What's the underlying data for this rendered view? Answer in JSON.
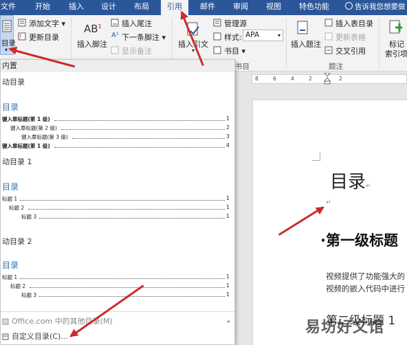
{
  "tabs": [
    "文件",
    "开始",
    "插入",
    "设计",
    "布局",
    "引用",
    "邮件",
    "审阅",
    "视图",
    "特色功能"
  ],
  "active_tab": "引用",
  "tell_me": "告诉我您想要做",
  "ribbon": {
    "toc_label": "目录",
    "add_text": "添加文字",
    "update_toc": "更新目录",
    "ab_icon": "AB",
    "ab_sup": "1",
    "insert_footnote": "插入脚注",
    "insert_endnote": "插入尾注",
    "next_footnote": "下一条脚注",
    "show_notes": "显示备注",
    "insert_citation": "插入引文",
    "manage_sources": "管理源",
    "style_label": "样式:",
    "style_value": "APA",
    "bibliography": "书目",
    "citation_group": "书目",
    "insert_caption": "插入题注",
    "insert_table_figures": "插入表目录",
    "update_table": "更新表格",
    "cross_reference": "交叉引用",
    "caption_group": "题注",
    "mark_entry": "标记",
    "mark_entry2": "索引项"
  },
  "dropdown": {
    "header": "内置",
    "auto1": "动目录",
    "toc_heading": "目录",
    "sample1": [
      {
        "text": "键入章标题(第 1 级)",
        "page": "1",
        "bold": true
      },
      {
        "text": "键入章标题(第 2 级)",
        "page": "2",
        "bold": false
      },
      {
        "text": "键入章标题(第 3 级)",
        "page": "3",
        "bold": false
      },
      {
        "text": "键入章标题(第 1 级)",
        "page": "4",
        "bold": true
      }
    ],
    "auto_toc_1": "动目录 1",
    "toc_heading_2": "目录",
    "sample2": [
      {
        "text": "标题 1",
        "page": "1"
      },
      {
        "text": "标题 2",
        "page": "1"
      },
      {
        "text": "标题 3",
        "page": "1"
      }
    ],
    "auto_toc_2": "动目录 2",
    "toc_heading_3": "目录",
    "sample3": [
      {
        "text": "标题 1",
        "page": "1"
      },
      {
        "text": "标题 2",
        "page": "1"
      },
      {
        "text": "标题 3",
        "page": "1"
      }
    ],
    "office_more": "Office.com 中的其他目录(M)",
    "custom_toc": "自定义目录(C)..."
  },
  "ruler_ticks": [
    "8",
    "6",
    "4",
    "2",
    "2"
  ],
  "document": {
    "title": "目录",
    "heading": "·第一级标题",
    "body_line1": "视频提供了功能强大的",
    "body_line2": "视频的嵌入代码中进行",
    "level_heading": "第二级标题 1",
    "watermark": "易坊好文馆"
  },
  "colors": {
    "accent": "#2b579a",
    "arrow": "#cc2b2b",
    "heading_blue": "#2e74b5"
  }
}
